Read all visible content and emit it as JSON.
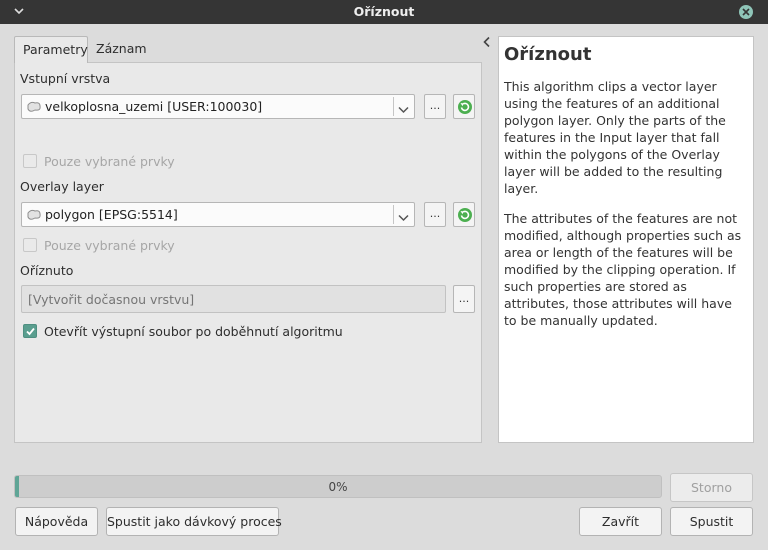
{
  "window": {
    "title": "Oříznout"
  },
  "tabs": [
    {
      "label": "Parametry",
      "active": true
    },
    {
      "label": "Záznam",
      "active": false
    }
  ],
  "params": {
    "input_layer": {
      "label": "Vstupní vrstva",
      "value": "velkoplosna_uzemi [USER:100030]",
      "selected_only_label": "Pouze vybrané prvky"
    },
    "overlay_layer": {
      "label": "Overlay layer",
      "value": "polygon [EPSG:5514]",
      "selected_only_label": "Pouze vybrané prvky"
    },
    "output": {
      "label": "Oříznuto",
      "placeholder": "[Vytvořit dočasnou vrstvu]"
    },
    "open_output": {
      "label": "Otevřít výstupní soubor po doběhnutí algoritmu",
      "checked": true
    },
    "browse_label": "..."
  },
  "help": {
    "title": "Oříznout",
    "paragraphs": [
      "This algorithm clips a vector layer using the features of an additional polygon layer. Only the parts of the features in the Input layer that fall within the polygons of the Overlay layer will be added to the resulting layer.",
      "The attributes of the features are not modified, although properties such as area or length of the features will be modified by the clipping operation. If such properties are stored as attributes, those attributes will have to be manually updated."
    ]
  },
  "progress": {
    "value": 0,
    "text": "0%"
  },
  "buttons": {
    "cancel": "Storno",
    "help": "Nápověda",
    "batch": "Spustit jako dávkový proces",
    "close": "Zavřít",
    "run": "Spustit"
  },
  "colors": {
    "accent": "#5fa596",
    "titlebar": "#353535"
  },
  "icons": {
    "layer": "polygon-layer-icon",
    "refresh": "iterate-icon",
    "close": "close-icon",
    "check": "check-icon"
  }
}
